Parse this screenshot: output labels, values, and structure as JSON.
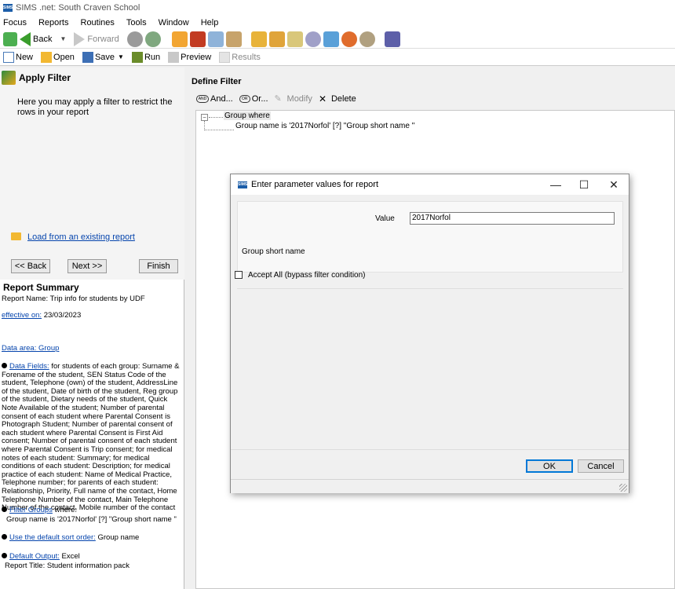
{
  "window": {
    "title": "SIMS .net: South Craven School",
    "logo": "SIMS"
  },
  "menu": [
    "Focus",
    "Reports",
    "Routines",
    "Tools",
    "Window",
    "Help"
  ],
  "toolbar": {
    "back": "Back",
    "forward": "Forward"
  },
  "toolbar2": {
    "new": "New",
    "open": "Open",
    "save": "Save",
    "run": "Run",
    "preview": "Preview",
    "results": "Results"
  },
  "left": {
    "title": "Apply Filter",
    "description": "Here you may apply a filter to  restrict the rows in your report",
    "load_link": "Load from an existing report",
    "back_btn": "<< Back",
    "next_btn": "Next >>",
    "finish_btn": "Finish",
    "summary_title": "Report Summary",
    "report_name": "Report Name: Trip info for students by UDF",
    "effective_link": "effective on:",
    "effective_date": "23/03/2023",
    "data_area_link": "Data area: Group",
    "data_fields_link": "Data Fields:",
    "data_fields_text": " for students of each group: Surname & Forename of the student, SEN Status Code of the student, Telephone (own) of the student, AddressLine of the student, Date of birth of the student, Reg group of the student, Dietary needs of the student, Quick Note Available of the student; Number of parental consent of each student where Parental Consent is Photograph Student; Number of parental consent of each student where Parental Consent is First Aid consent; Number of parental consent of each student where Parental Consent is Trip consent; for medical notes of each student: Summary; for medical conditions of each student: Description; for medical practice of each student: Name of Medical Practice, Telephone number; for parents of each student: Relationship, Priority, Full name of the contact, Home Telephone Number of the contact, Main Telephone Number of the contact, Mobile number of the contact",
    "filter_groups_link": "Filter Groups",
    "filter_groups_text": " where:",
    "filter_groups_detail": "Group name is '2017Norfol' [?] \"Group short name \"",
    "sort_link": "Use the default sort order:",
    "sort_text": " Group name",
    "output_link": "Default Output:",
    "output_text": " Excel",
    "report_title": "Report Title: Student information pack"
  },
  "right": {
    "title": "Define Filter",
    "and_btn": "And...",
    "or_btn": "Or...",
    "modify_btn": "Modify",
    "delete_btn": "Delete",
    "tree_root": "Group where",
    "tree_child": "Group name is '2017Norfol' [?] \"Group short name \""
  },
  "dialog": {
    "logo": "SIMS",
    "title": "Enter parameter values for report",
    "minimize": "—",
    "maximize": "☐",
    "close": "✕",
    "value_label": "Value",
    "value_input": "2017Norfol",
    "group_short_name": "Group short name",
    "accept_all": "Accept All (bypass filter condition)",
    "ok": "OK",
    "cancel": "Cancel"
  },
  "colors": {
    "accent": "#0078d7",
    "link": "#0645ad",
    "green": "#3a9d2c"
  },
  "icons": [
    "back-icon",
    "forward-icon",
    "new-icon",
    "open-icon",
    "save-icon",
    "run-icon",
    "preview-icon",
    "results-icon",
    "folder-icon",
    "delete-icon",
    "modify-icon"
  ]
}
